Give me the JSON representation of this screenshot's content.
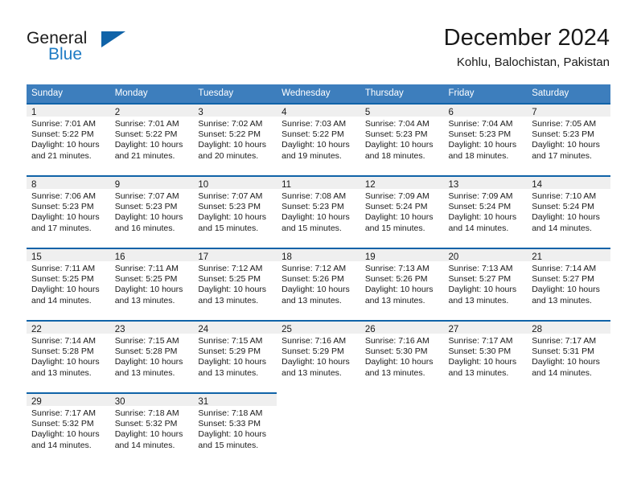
{
  "brand": {
    "name_part1": "General",
    "name_part2": "Blue",
    "flag_icon": "triangle-flag-icon"
  },
  "header": {
    "title": "December 2024",
    "subtitle": "Kohlu, Balochistan, Pakistan"
  },
  "colors": {
    "header_blue": "#3d7ebd",
    "accent_blue": "#1063a8",
    "brand_blue": "#1e7bc4",
    "day_banner_gray": "#efefef",
    "text": "#1a1a1a"
  },
  "weekday_headers": [
    "Sunday",
    "Monday",
    "Tuesday",
    "Wednesday",
    "Thursday",
    "Friday",
    "Saturday"
  ],
  "labels": {
    "sunrise": "Sunrise:",
    "sunset": "Sunset:",
    "daylight": "Daylight:"
  },
  "weeks": [
    [
      {
        "day": "1",
        "sunrise": "Sunrise: 7:01 AM",
        "sunset": "Sunset: 5:22 PM",
        "daylight_line1": "Daylight: 10 hours",
        "daylight_line2": "and 21 minutes."
      },
      {
        "day": "2",
        "sunrise": "Sunrise: 7:01 AM",
        "sunset": "Sunset: 5:22 PM",
        "daylight_line1": "Daylight: 10 hours",
        "daylight_line2": "and 21 minutes."
      },
      {
        "day": "3",
        "sunrise": "Sunrise: 7:02 AM",
        "sunset": "Sunset: 5:22 PM",
        "daylight_line1": "Daylight: 10 hours",
        "daylight_line2": "and 20 minutes."
      },
      {
        "day": "4",
        "sunrise": "Sunrise: 7:03 AM",
        "sunset": "Sunset: 5:22 PM",
        "daylight_line1": "Daylight: 10 hours",
        "daylight_line2": "and 19 minutes."
      },
      {
        "day": "5",
        "sunrise": "Sunrise: 7:04 AM",
        "sunset": "Sunset: 5:23 PM",
        "daylight_line1": "Daylight: 10 hours",
        "daylight_line2": "and 18 minutes."
      },
      {
        "day": "6",
        "sunrise": "Sunrise: 7:04 AM",
        "sunset": "Sunset: 5:23 PM",
        "daylight_line1": "Daylight: 10 hours",
        "daylight_line2": "and 18 minutes."
      },
      {
        "day": "7",
        "sunrise": "Sunrise: 7:05 AM",
        "sunset": "Sunset: 5:23 PM",
        "daylight_line1": "Daylight: 10 hours",
        "daylight_line2": "and 17 minutes."
      }
    ],
    [
      {
        "day": "8",
        "sunrise": "Sunrise: 7:06 AM",
        "sunset": "Sunset: 5:23 PM",
        "daylight_line1": "Daylight: 10 hours",
        "daylight_line2": "and 17 minutes."
      },
      {
        "day": "9",
        "sunrise": "Sunrise: 7:07 AM",
        "sunset": "Sunset: 5:23 PM",
        "daylight_line1": "Daylight: 10 hours",
        "daylight_line2": "and 16 minutes."
      },
      {
        "day": "10",
        "sunrise": "Sunrise: 7:07 AM",
        "sunset": "Sunset: 5:23 PM",
        "daylight_line1": "Daylight: 10 hours",
        "daylight_line2": "and 15 minutes."
      },
      {
        "day": "11",
        "sunrise": "Sunrise: 7:08 AM",
        "sunset": "Sunset: 5:23 PM",
        "daylight_line1": "Daylight: 10 hours",
        "daylight_line2": "and 15 minutes."
      },
      {
        "day": "12",
        "sunrise": "Sunrise: 7:09 AM",
        "sunset": "Sunset: 5:24 PM",
        "daylight_line1": "Daylight: 10 hours",
        "daylight_line2": "and 15 minutes."
      },
      {
        "day": "13",
        "sunrise": "Sunrise: 7:09 AM",
        "sunset": "Sunset: 5:24 PM",
        "daylight_line1": "Daylight: 10 hours",
        "daylight_line2": "and 14 minutes."
      },
      {
        "day": "14",
        "sunrise": "Sunrise: 7:10 AM",
        "sunset": "Sunset: 5:24 PM",
        "daylight_line1": "Daylight: 10 hours",
        "daylight_line2": "and 14 minutes."
      }
    ],
    [
      {
        "day": "15",
        "sunrise": "Sunrise: 7:11 AM",
        "sunset": "Sunset: 5:25 PM",
        "daylight_line1": "Daylight: 10 hours",
        "daylight_line2": "and 14 minutes."
      },
      {
        "day": "16",
        "sunrise": "Sunrise: 7:11 AM",
        "sunset": "Sunset: 5:25 PM",
        "daylight_line1": "Daylight: 10 hours",
        "daylight_line2": "and 13 minutes."
      },
      {
        "day": "17",
        "sunrise": "Sunrise: 7:12 AM",
        "sunset": "Sunset: 5:25 PM",
        "daylight_line1": "Daylight: 10 hours",
        "daylight_line2": "and 13 minutes."
      },
      {
        "day": "18",
        "sunrise": "Sunrise: 7:12 AM",
        "sunset": "Sunset: 5:26 PM",
        "daylight_line1": "Daylight: 10 hours",
        "daylight_line2": "and 13 minutes."
      },
      {
        "day": "19",
        "sunrise": "Sunrise: 7:13 AM",
        "sunset": "Sunset: 5:26 PM",
        "daylight_line1": "Daylight: 10 hours",
        "daylight_line2": "and 13 minutes."
      },
      {
        "day": "20",
        "sunrise": "Sunrise: 7:13 AM",
        "sunset": "Sunset: 5:27 PM",
        "daylight_line1": "Daylight: 10 hours",
        "daylight_line2": "and 13 minutes."
      },
      {
        "day": "21",
        "sunrise": "Sunrise: 7:14 AM",
        "sunset": "Sunset: 5:27 PM",
        "daylight_line1": "Daylight: 10 hours",
        "daylight_line2": "and 13 minutes."
      }
    ],
    [
      {
        "day": "22",
        "sunrise": "Sunrise: 7:14 AM",
        "sunset": "Sunset: 5:28 PM",
        "daylight_line1": "Daylight: 10 hours",
        "daylight_line2": "and 13 minutes."
      },
      {
        "day": "23",
        "sunrise": "Sunrise: 7:15 AM",
        "sunset": "Sunset: 5:28 PM",
        "daylight_line1": "Daylight: 10 hours",
        "daylight_line2": "and 13 minutes."
      },
      {
        "day": "24",
        "sunrise": "Sunrise: 7:15 AM",
        "sunset": "Sunset: 5:29 PM",
        "daylight_line1": "Daylight: 10 hours",
        "daylight_line2": "and 13 minutes."
      },
      {
        "day": "25",
        "sunrise": "Sunrise: 7:16 AM",
        "sunset": "Sunset: 5:29 PM",
        "daylight_line1": "Daylight: 10 hours",
        "daylight_line2": "and 13 minutes."
      },
      {
        "day": "26",
        "sunrise": "Sunrise: 7:16 AM",
        "sunset": "Sunset: 5:30 PM",
        "daylight_line1": "Daylight: 10 hours",
        "daylight_line2": "and 13 minutes."
      },
      {
        "day": "27",
        "sunrise": "Sunrise: 7:17 AM",
        "sunset": "Sunset: 5:30 PM",
        "daylight_line1": "Daylight: 10 hours",
        "daylight_line2": "and 13 minutes."
      },
      {
        "day": "28",
        "sunrise": "Sunrise: 7:17 AM",
        "sunset": "Sunset: 5:31 PM",
        "daylight_line1": "Daylight: 10 hours",
        "daylight_line2": "and 14 minutes."
      }
    ],
    [
      {
        "day": "29",
        "sunrise": "Sunrise: 7:17 AM",
        "sunset": "Sunset: 5:32 PM",
        "daylight_line1": "Daylight: 10 hours",
        "daylight_line2": "and 14 minutes."
      },
      {
        "day": "30",
        "sunrise": "Sunrise: 7:18 AM",
        "sunset": "Sunset: 5:32 PM",
        "daylight_line1": "Daylight: 10 hours",
        "daylight_line2": "and 14 minutes."
      },
      {
        "day": "31",
        "sunrise": "Sunrise: 7:18 AM",
        "sunset": "Sunset: 5:33 PM",
        "daylight_line1": "Daylight: 10 hours",
        "daylight_line2": "and 15 minutes."
      },
      {
        "day": "",
        "sunrise": "",
        "sunset": "",
        "daylight_line1": "",
        "daylight_line2": ""
      },
      {
        "day": "",
        "sunrise": "",
        "sunset": "",
        "daylight_line1": "",
        "daylight_line2": ""
      },
      {
        "day": "",
        "sunrise": "",
        "sunset": "",
        "daylight_line1": "",
        "daylight_line2": ""
      },
      {
        "day": "",
        "sunrise": "",
        "sunset": "",
        "daylight_line1": "",
        "daylight_line2": ""
      }
    ]
  ]
}
